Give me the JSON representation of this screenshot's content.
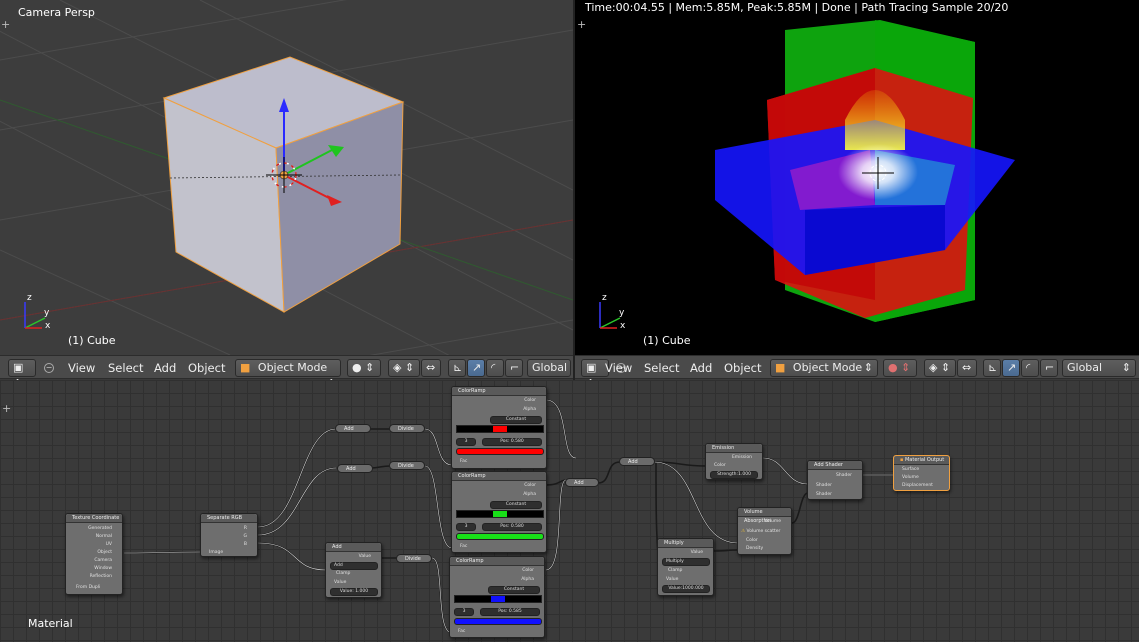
{
  "viewport_left": {
    "title": "Camera Persp",
    "object_label": "(1) Cube"
  },
  "viewport_right": {
    "status": "Time:00:04.55 | Mem:5.85M, Peak:5.85M | Done | Path Tracing Sample 20/20",
    "object_label": "(1) Cube"
  },
  "header_left": {
    "menus": [
      "View",
      "Select",
      "Add",
      "Object"
    ],
    "mode": "Object Mode",
    "orientation": "Global"
  },
  "header_right": {
    "menus": [
      "View",
      "Select",
      "Add",
      "Object"
    ],
    "mode": "Object Mode",
    "orientation": "Global"
  },
  "axis": {
    "x": "x",
    "y": "y",
    "z": "z"
  },
  "node_editor": {
    "label": "Material",
    "nodes": {
      "texcoord": {
        "title": "Texture Coordinate",
        "outputs": [
          "Generated",
          "Normal",
          "UV",
          "Object",
          "Camera",
          "Window",
          "Reflection"
        ],
        "from_dupli": "From Dupli"
      },
      "separate": {
        "title": "Separate RGB",
        "outputs": [
          "R",
          "G",
          "B"
        ],
        "input": "Image"
      },
      "add_math": {
        "title": "Add",
        "out": "Value",
        "op": "Add",
        "clamp": "Clamp",
        "in_label": "Value",
        "value": "Value:   1.000"
      },
      "add1": "Add",
      "divide1": "Divide",
      "add2": "Add",
      "divide2": "Divide",
      "divide3": "Divide",
      "ramp_r": {
        "title": "ColorRamp",
        "color": "Color",
        "alpha": "Alpha",
        "mode": "Constant",
        "index": "3",
        "pos": "Pos:",
        "pos_val": "0.580",
        "fac": "Fac"
      },
      "ramp_g": {
        "title": "ColorRamp",
        "color": "Color",
        "alpha": "Alpha",
        "mode": "Constant",
        "index": "3",
        "pos": "Pos:",
        "pos_val": "0.580",
        "fac": "Fac"
      },
      "ramp_b": {
        "title": "ColorRamp",
        "color": "Color",
        "alpha": "Alpha",
        "mode": "Constant",
        "index": "3",
        "pos": "Pos:",
        "pos_val": "0.585",
        "fac": "Fac"
      },
      "add3": "Add",
      "add4": "Add",
      "emission": {
        "title": "Emission",
        "out": "Emission",
        "color": "Color",
        "strength": "Strength:1.000"
      },
      "volume": {
        "title": "Volume Absorption",
        "out": "Volume",
        "warn": "Volume scatter",
        "color": "Color",
        "density": "Density"
      },
      "multiply": {
        "title": "Multiply",
        "out": "Value",
        "op": "Multiply",
        "clamp": "Clamp",
        "in_label": "Value",
        "value": "Value:1000.000"
      },
      "add_shader": {
        "title": "Add Shader",
        "out": "Shader",
        "in1": "Shader",
        "in2": "Shader"
      },
      "output": {
        "title": "Material Output",
        "in1": "Surface",
        "in2": "Volume",
        "in3": "Displacement"
      }
    }
  },
  "colors": {
    "ramp_red": "#ff0000",
    "ramp_green": "#18e018",
    "ramp_blue": "#1010ff",
    "cube": "#b7b7c4",
    "selection": "#f0a040"
  },
  "icons": [
    "mesh-cube-icon",
    "menu-collapse-icon",
    "shading-solid-icon",
    "pivot-icon",
    "manipulator-icon",
    "translate-icon",
    "rotate-icon",
    "scale-icon",
    "cursor-icon"
  ]
}
